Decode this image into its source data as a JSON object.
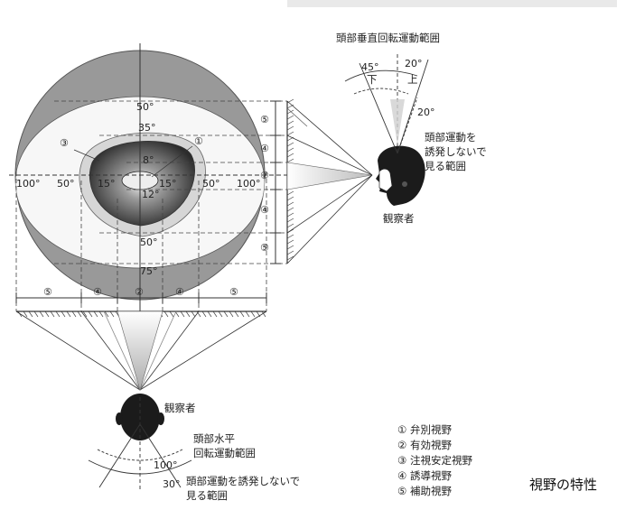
{
  "caption": "視野の特性",
  "vertical_head_label": "頭部垂直回転運動範囲",
  "vertical_down": "下",
  "vertical_up": "上",
  "angle_45": "45°",
  "angle_20_up": "20°",
  "angle_20_eye": "20°",
  "vertical_no_head_motion": [
    "頭部運動を",
    "誘発しないで",
    "見る範囲"
  ],
  "observer_side": "観察者",
  "observer_bottom": "観察者",
  "horizontal_head_label": [
    "頭部水平",
    "回転運動範囲"
  ],
  "horizontal_no_head_motion": [
    "頭部運動を誘発しないで",
    "見る範囲"
  ],
  "angle_100_bottom": "100°",
  "angle_30_bottom": "30°",
  "field_angles": {
    "top50": "50°",
    "top35": "35°",
    "inner8": "8°",
    "left100": "100°",
    "left50": "50°",
    "left15": "15°",
    "right15": "15°",
    "right50": "50°",
    "right100": "100°",
    "inner12": "12°",
    "bottom50": "50°",
    "bottom75": "75°"
  },
  "circled": {
    "c1": "①",
    "c2": "②",
    "c3": "③",
    "c4": "④",
    "c5": "⑤"
  },
  "legend": [
    {
      "num": "①",
      "text": "弁別視野"
    },
    {
      "num": "②",
      "text": "有効視野"
    },
    {
      "num": "③",
      "text": "注視安定視野"
    },
    {
      "num": "④",
      "text": "誘導視野"
    },
    {
      "num": "⑤",
      "text": "補助視野"
    }
  ]
}
